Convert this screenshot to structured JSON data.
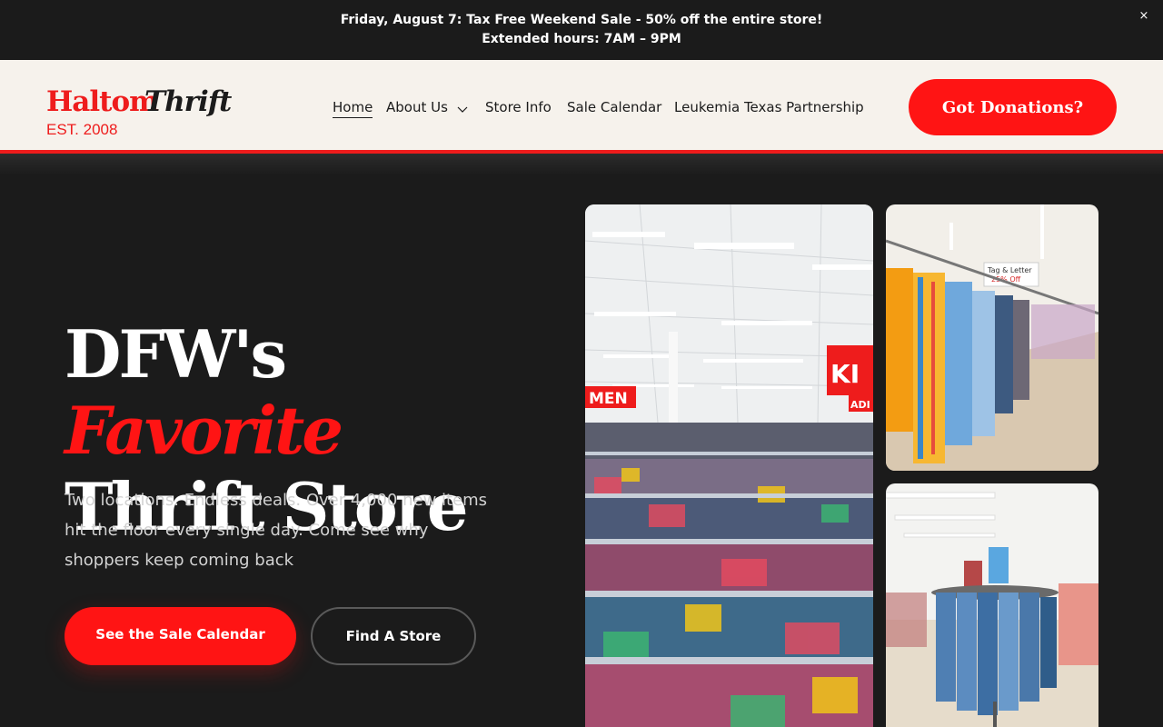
{
  "announcement": {
    "line1": "Friday, August 7: Tax Free Weekend Sale - 50% off the entire store!",
    "line2": "Extended hours: 7AM – 9PM",
    "close_label": "×"
  },
  "brand": {
    "name_part1": "Haltom",
    "name_part2": "Thrift",
    "established": "EST. 2008",
    "accent_color": "#ee1c1c",
    "dark_color": "#1b1b1b",
    "cream_color": "#f6f2ec"
  },
  "nav": {
    "items": [
      {
        "label": "Home"
      },
      {
        "label": "About Us"
      },
      {
        "label": "Store Info"
      },
      {
        "label": "Sale Calendar"
      },
      {
        "label": "Leukemia Texas Partnership"
      }
    ],
    "donate_label": "Got Donations?"
  },
  "hero": {
    "title_part1": "DFW's",
    "title_accent": "Favorite",
    "title_part2": "Thrift Store",
    "subtitle": "Two locations. Endless deals. Over 4,000 new items hit the floor every single day. Come see why shoppers keep coming back",
    "primary_button": "See the Sale Calendar",
    "secondary_button": "Find A Store"
  },
  "photos": {
    "main_sign_text": "MEN",
    "main_sign_text2": "KI",
    "main_sign_text3": "ADI",
    "shirts_sign_line1": "Tag & Letter",
    "shirts_sign_line2": "25% Off"
  }
}
